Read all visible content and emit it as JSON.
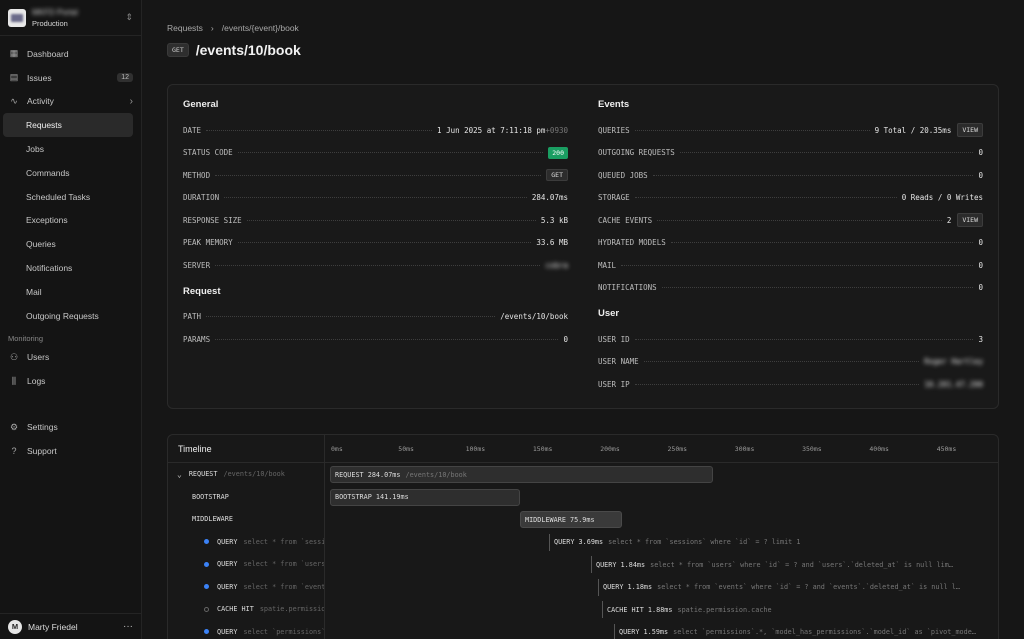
{
  "sidebar": {
    "org_name": "MKFD Portal",
    "org_env": "Production",
    "nav": [
      {
        "label": "Dashboard",
        "icon": "dashboard-icon"
      },
      {
        "label": "Issues",
        "icon": "inbox-icon",
        "badge": "12"
      },
      {
        "label": "Activity",
        "icon": "activity-icon"
      }
    ],
    "activity_items": [
      "Requests",
      "Jobs",
      "Commands",
      "Scheduled Tasks",
      "Exceptions",
      "Queries",
      "Notifications",
      "Mail",
      "Outgoing Requests"
    ],
    "monitoring_label": "Monitoring",
    "monitoring_items": [
      "Users",
      "Logs"
    ],
    "bottom_items": [
      "Settings",
      "Support"
    ],
    "user": {
      "initial": "M",
      "name": "Marty Friedel"
    }
  },
  "breadcrumb": {
    "root": "Requests",
    "route": "/events/{event}/book"
  },
  "header": {
    "method": "GET",
    "title": "/events/10/book"
  },
  "general": {
    "title": "General",
    "date_label": "DATE",
    "date": "1 Jun 2025 at 7:11:18 pm",
    "tz": "+0930",
    "status_label": "STATUS CODE",
    "status": "200",
    "method_label": "METHOD",
    "method": "GET",
    "duration_label": "DURATION",
    "duration": "284.07ms",
    "response_label": "RESPONSE SIZE",
    "response": "5.3 kB",
    "memory_label": "PEAK MEMORY",
    "memory": "33.6 MB",
    "server_label": "SERVER",
    "server": "cobra"
  },
  "request": {
    "title": "Request",
    "path_label": "PATH",
    "path": "/events/10/book",
    "params_label": "PARAMS",
    "params": "0"
  },
  "events": {
    "title": "Events",
    "queries_label": "QUERIES",
    "queries": "9 Total / 20.35ms",
    "outgoing_label": "OUTGOING REQUESTS",
    "outgoing": "0",
    "queued_label": "QUEUED JOBS",
    "queued": "0",
    "storage_label": "STORAGE",
    "storage": "0 Reads / 0 Writes",
    "cache_label": "CACHE EVENTS",
    "cache": "2",
    "hydrated_label": "HYDRATED MODELS",
    "hydrated": "0",
    "mail_label": "MAIL",
    "mail": "0",
    "notifications_label": "NOTIFICATIONS",
    "notifications": "0",
    "view_label": "VIEW"
  },
  "user_info": {
    "title": "User",
    "id_label": "USER ID",
    "id": "3",
    "name_label": "USER NAME",
    "name": "Roger Hartley",
    "ip_label": "USER IP",
    "ip": "10.201.47.200"
  },
  "timeline": {
    "title": "Timeline",
    "ticks": [
      "0ms",
      "50ms",
      "100ms",
      "150ms",
      "200ms",
      "250ms",
      "300ms",
      "350ms",
      "400ms",
      "450ms"
    ],
    "rows": [
      {
        "label": "REQUEST",
        "detail": "/events/10/book",
        "bar_text": "REQUEST 284.07ms",
        "bar_detail": "/events/10/book"
      },
      {
        "label": "BOOTSTRAP",
        "bar_text": "BOOTSTRAP 141.19ms"
      },
      {
        "label": "MIDDLEWARE",
        "bar_text": "MIDDLEWARE 75.9ms"
      },
      {
        "label": "QUERY",
        "detail": "select * from `sessions`",
        "bar_text": "QUERY 3.69ms",
        "bar_detail": "select * from `sessions` where `id` = ? limit 1"
      },
      {
        "label": "QUERY",
        "detail": "select * from `users`",
        "bar_text": "QUERY 1.84ms",
        "bar_detail": "select * from `users` where `id` = ? and `users`.`deleted_at` is null lim…"
      },
      {
        "label": "QUERY",
        "detail": "select * from `events`",
        "bar_text": "QUERY 1.18ms",
        "bar_detail": "select * from `events` where `id` = ? and `events`.`deleted_at` is null l…"
      },
      {
        "label": "CACHE HIT",
        "detail": "spatie.permission.cache",
        "bar_text": "CACHE HIT 1.88ms",
        "bar_detail": "spatie.permission.cache"
      },
      {
        "label": "QUERY",
        "detail": "select `permissions`.*",
        "bar_text": "QUERY 1.59ms",
        "bar_detail": "select `permissions`.*, `model_has_permissions`.`model_id` as `pivot_mode…"
      }
    ]
  }
}
